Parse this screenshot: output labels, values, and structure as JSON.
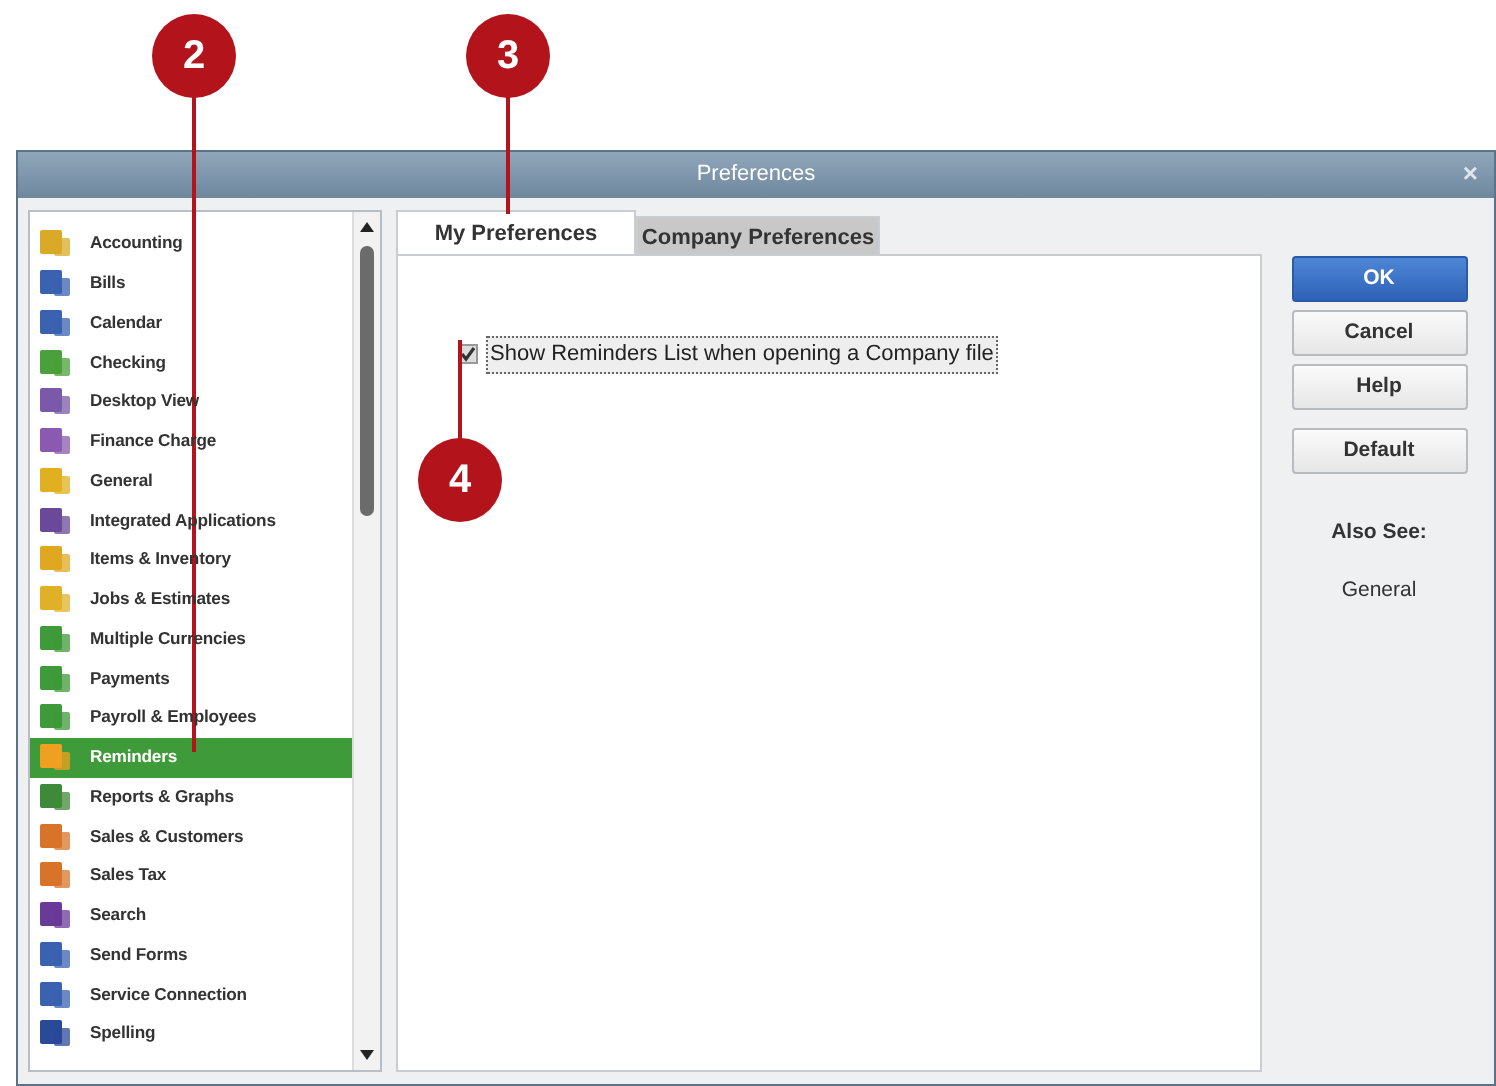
{
  "callouts": [
    {
      "label": "2"
    },
    {
      "label": "3"
    },
    {
      "label": "4"
    }
  ],
  "window": {
    "title": "Preferences",
    "close": "×"
  },
  "sidebar": {
    "items": [
      {
        "label": "Accounting",
        "color": "#d9a928",
        "selected": false
      },
      {
        "label": "Bills",
        "color": "#3a62b0",
        "selected": false
      },
      {
        "label": "Calendar",
        "color": "#3a62b0",
        "selected": false
      },
      {
        "label": "Checking",
        "color": "#4aa03a",
        "selected": false
      },
      {
        "label": "Desktop View",
        "color": "#7a5aa8",
        "selected": false
      },
      {
        "label": "Finance Charge",
        "color": "#8a5ab0",
        "selected": false
      },
      {
        "label": "General",
        "color": "#e0b020",
        "selected": false
      },
      {
        "label": "Integrated Applications",
        "color": "#6a4a98",
        "selected": false
      },
      {
        "label": "Items & Inventory",
        "color": "#e0a820",
        "selected": false
      },
      {
        "label": "Jobs & Estimates",
        "color": "#e0b028",
        "selected": false
      },
      {
        "label": "Multiple Currencies",
        "color": "#3f9a3a",
        "selected": false
      },
      {
        "label": "Payments",
        "color": "#3f9a3a",
        "selected": false
      },
      {
        "label": "Payroll & Employees",
        "color": "#3f9a3a",
        "selected": false
      },
      {
        "label": "Reminders",
        "color": "#f0a020",
        "selected": true
      },
      {
        "label": "Reports & Graphs",
        "color": "#3f8a3a",
        "selected": false
      },
      {
        "label": "Sales & Customers",
        "color": "#d8742a",
        "selected": false
      },
      {
        "label": "Sales Tax",
        "color": "#d8742a",
        "selected": false
      },
      {
        "label": "Search",
        "color": "#6a3a98",
        "selected": false
      },
      {
        "label": "Send Forms",
        "color": "#3a62b0",
        "selected": false
      },
      {
        "label": "Service Connection",
        "color": "#3a62b0",
        "selected": false
      },
      {
        "label": "Spelling",
        "color": "#2a4a98",
        "selected": false
      }
    ]
  },
  "tabs": [
    {
      "label": "My Preferences",
      "selected": true
    },
    {
      "label": "Company Preferences",
      "selected": false
    }
  ],
  "options": [
    {
      "label": "Show Reminders List when opening a Company file",
      "checked": true
    }
  ],
  "buttons": [
    {
      "label": "OK",
      "kind": "primary"
    },
    {
      "label": "Cancel",
      "kind": "normal"
    },
    {
      "label": "Help",
      "kind": "normal"
    },
    {
      "label": "Default",
      "kind": "normal"
    }
  ],
  "also_see": {
    "title": "Also See:",
    "links": [
      "General"
    ]
  }
}
